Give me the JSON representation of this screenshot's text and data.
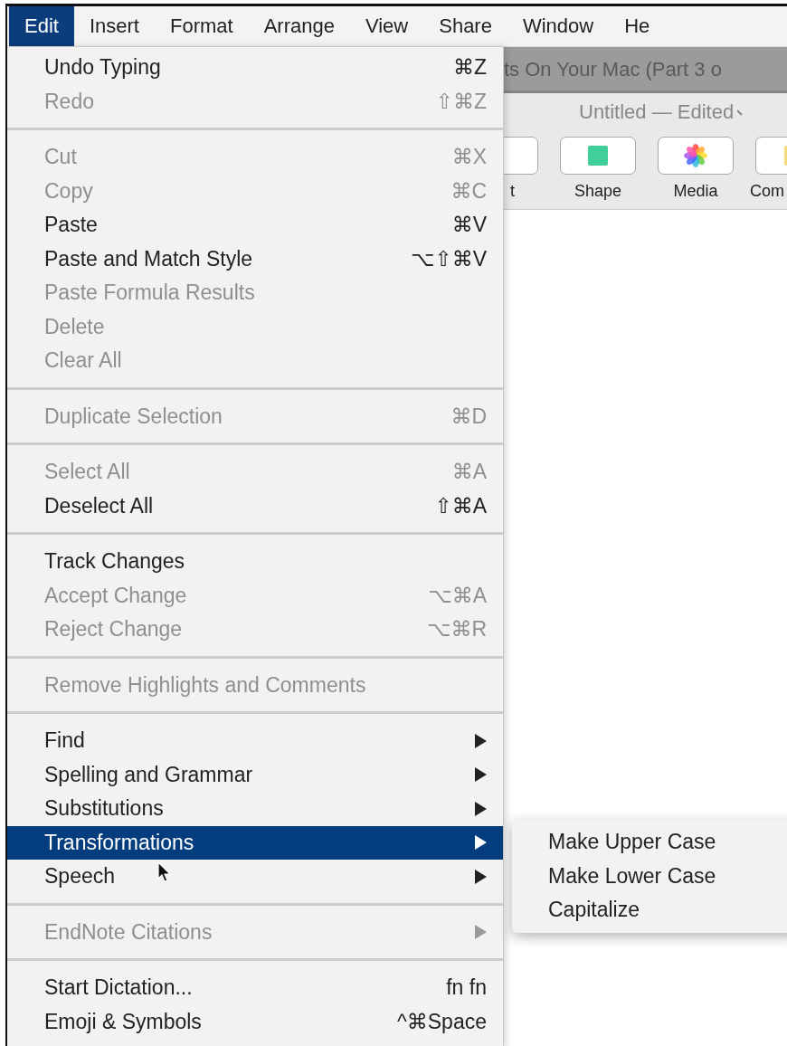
{
  "menu_bar": [
    {
      "label": "Edit",
      "selected": true
    },
    {
      "label": "Insert",
      "selected": false
    },
    {
      "label": "Format",
      "selected": false
    },
    {
      "label": "Arrange",
      "selected": false
    },
    {
      "label": "View",
      "selected": false
    },
    {
      "label": "Share",
      "selected": false
    },
    {
      "label": "Window",
      "selected": false
    },
    {
      "label": "He",
      "selected": false
    }
  ],
  "window": {
    "title": "ts On Your Mac (Part 3 o",
    "document_title": "Untitled — Edited",
    "toolbar": [
      {
        "label": "t",
        "kind": "blank"
      },
      {
        "label": "Shape",
        "kind": "shape"
      },
      {
        "label": "Media",
        "kind": "media"
      },
      {
        "label": "Com",
        "kind": "comment"
      }
    ]
  },
  "edit_menu": {
    "groups": [
      {
        "items": [
          {
            "label": "Undo Typing",
            "shortcut": "⌘Z",
            "disabled": false,
            "selected": false,
            "kind": "command"
          },
          {
            "label": "Redo",
            "shortcut": "⇧⌘Z",
            "disabled": true,
            "selected": false,
            "kind": "command"
          }
        ]
      },
      {
        "items": [
          {
            "label": "Cut",
            "shortcut": "⌘X",
            "disabled": true,
            "selected": false,
            "kind": "command"
          },
          {
            "label": "Copy",
            "shortcut": "⌘C",
            "disabled": true,
            "selected": false,
            "kind": "command"
          },
          {
            "label": "Paste",
            "shortcut": "⌘V",
            "disabled": false,
            "selected": false,
            "kind": "command"
          },
          {
            "label": "Paste and Match Style",
            "shortcut": "⌥⇧⌘V",
            "disabled": false,
            "selected": false,
            "kind": "command"
          },
          {
            "label": "Paste Formula Results",
            "disabled": true,
            "selected": false,
            "kind": "command"
          },
          {
            "label": "Delete",
            "disabled": true,
            "selected": false,
            "kind": "command"
          },
          {
            "label": "Clear All",
            "disabled": true,
            "selected": false,
            "kind": "command"
          }
        ]
      },
      {
        "items": [
          {
            "label": "Duplicate Selection",
            "shortcut": "⌘D",
            "disabled": true,
            "selected": false,
            "kind": "command"
          }
        ]
      },
      {
        "items": [
          {
            "label": "Select All",
            "shortcut": "⌘A",
            "disabled": true,
            "selected": false,
            "kind": "command"
          },
          {
            "label": "Deselect All",
            "shortcut": "⇧⌘A",
            "disabled": false,
            "selected": false,
            "kind": "command"
          }
        ]
      },
      {
        "items": [
          {
            "label": "Track Changes",
            "disabled": false,
            "selected": false,
            "kind": "command"
          },
          {
            "label": "Accept Change",
            "shortcut": "⌥⌘A",
            "disabled": true,
            "selected": false,
            "kind": "command"
          },
          {
            "label": "Reject Change",
            "shortcut": "⌥⌘R",
            "disabled": true,
            "selected": false,
            "kind": "command"
          }
        ]
      },
      {
        "items": [
          {
            "label": "Remove Highlights and Comments",
            "disabled": true,
            "selected": false,
            "kind": "command"
          }
        ]
      },
      {
        "items": [
          {
            "label": "Find",
            "disabled": false,
            "selected": false,
            "kind": "submenu"
          },
          {
            "label": "Spelling and Grammar",
            "disabled": false,
            "selected": false,
            "kind": "submenu"
          },
          {
            "label": "Substitutions",
            "disabled": false,
            "selected": false,
            "kind": "submenu"
          },
          {
            "label": "Transformations",
            "disabled": false,
            "selected": true,
            "kind": "submenu"
          },
          {
            "label": "Speech",
            "disabled": false,
            "selected": false,
            "kind": "submenu"
          }
        ]
      },
      {
        "items": [
          {
            "label": "EndNote Citations",
            "disabled": true,
            "selected": false,
            "kind": "submenu"
          }
        ]
      },
      {
        "items": [
          {
            "label": "Start Dictation...",
            "shortcut": "fn fn",
            "disabled": false,
            "selected": false,
            "kind": "command"
          },
          {
            "label": "Emoji & Symbols",
            "shortcut": "^⌘Space",
            "disabled": false,
            "selected": false,
            "kind": "command"
          }
        ]
      }
    ]
  },
  "submenu": {
    "items": [
      {
        "label": "Make Upper Case"
      },
      {
        "label": "Make Lower Case"
      },
      {
        "label": "Capitalize"
      }
    ]
  }
}
